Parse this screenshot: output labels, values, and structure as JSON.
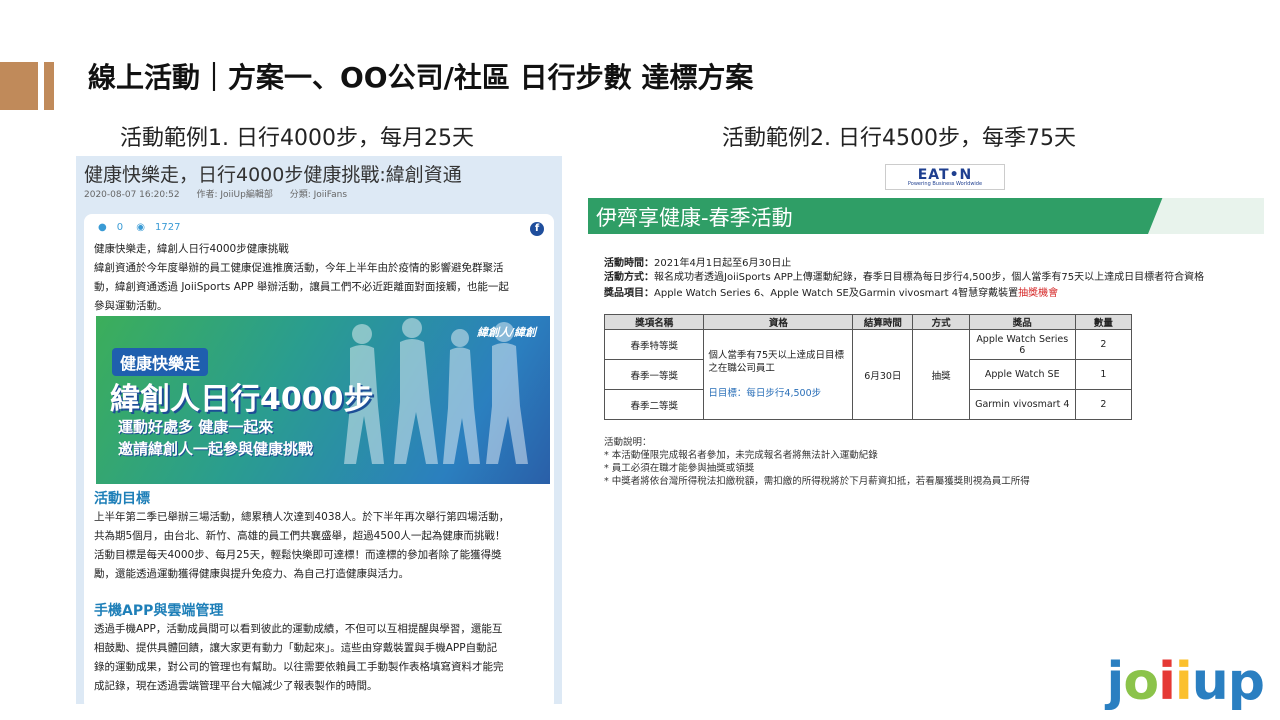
{
  "slide": {
    "title": "線上活動｜方案一、OO公司/社區 日行步數 達標方案",
    "example1": "活動範例1. 日行4000步，每月25天",
    "example2": "活動範例2. 日行4500步，每季75天"
  },
  "left": {
    "headline": "健康快樂走，日行4000步健康挑戰:緯創資通",
    "meta": [
      "2020-08-07 16:20:52",
      "作者: JoiiUp編輯部",
      "分類: JoiiFans"
    ],
    "comments": "0",
    "views": "1727",
    "intro_title": "健康快樂走，緯創人日行4000步健康挑戰",
    "intro_lines": [
      "緯創資通於今年度舉辦的員工健康促進推廣活動，今年上半年由於疫情的影響避免群聚活",
      "動，緯創資通透過 JoiiSports APP 舉辦活動，讓員工們不必近距離面對面接觸，也能一起",
      "參與運動活動。"
    ],
    "banner": {
      "brand": "緯創人/緯創",
      "tag": "健康快樂走",
      "main": "緯創人日行4000步",
      "line1": "運動好處多 健康一起來",
      "line2": "邀請緯創人一起參與健康挑戰"
    },
    "section1_title": "活動目標",
    "section1_lines": [
      "上半年第二季已舉辦三場活動，總累積人次達到4038人。於下半年再次舉行第四場活動，",
      "共為期5個月，由台北、新竹、高雄的員工們共襄盛舉，超過4500人一起為健康而挑戰！",
      "活動目標是每天4000步、每月25天，輕鬆快樂即可達標！而達標的參加者除了能獲得獎",
      "勵，還能透過運動獲得健康與提升免疫力、為自己打造健康與活力。"
    ],
    "section2_title": "手機APP與雲端管理",
    "section2_lines": [
      "透過手機APP，活動成員間可以看到彼此的運動成績，不但可以互相提醒與學習，還能互",
      "相鼓勵、提供具體回饋，讓大家更有動力「動起來」。這些由穿戴裝置與手機APP自動記",
      "錄的運動成果，對公司的管理也有幫助。以往需要依賴員工手動製作表格填寫資料才能完",
      "成記錄，現在透過雲端管理平台大幅減少了報表製作的時間。"
    ]
  },
  "right": {
    "logo": "EAT•N",
    "logo_sub": "Powering Business Worldwide",
    "title": "伊齊享健康-春季活動",
    "time_label": "活動時間：",
    "time_value": "2021年4月1日起至6月30日止",
    "method_label": "活動方式：",
    "method_value": "報名成功者透過JoiiSports APP上傳運動紀錄，春季日目標為每日步行4,500步，個人當季有75天以上達成日目標者符合資格",
    "prize_label": "獎品項目：",
    "prize_value": "Apple Watch Series 6、Apple Watch SE及Garmin vivosmart 4智慧穿戴裝置",
    "prize_red": "抽獎機會",
    "table": {
      "headers": [
        "獎項名稱",
        "資格",
        "結算時間",
        "方式",
        "獎品",
        "數量"
      ],
      "rows": [
        {
          "name": "春季特等獎",
          "prize": "Apple Watch Series 6",
          "qty": "2"
        },
        {
          "name": "春季一等獎",
          "prize": "Apple Watch SE",
          "qty": "1"
        },
        {
          "name": "春季二等獎",
          "prize": "Garmin vivosmart 4",
          "qty": "2"
        }
      ],
      "condition_line1": "個人當季有75天以上達成日目標",
      "condition_line2": "之在職公司員工",
      "condition_line3": "日目標：每日步行4,500步",
      "settle": "6月30日",
      "method": "抽獎"
    },
    "notes": [
      "活動說明：",
      "* 本活動僅限完成報名者參加，未完成報名者將無法計入運動紀錄",
      "* 員工必須在職才能參與抽獎或領獎",
      "* 中獎者將依台灣所得稅法扣繳稅額，需扣繳的所得稅將於下月薪資扣抵，若看屬獲獎則視為員工所得"
    ]
  },
  "brand_logo": {
    "text": "joiiup",
    "colors": [
      "#2a7fc1",
      "#8bc34a",
      "#e53935",
      "#fbc02d",
      "#2a7fc1",
      "#2a7fc1"
    ]
  }
}
